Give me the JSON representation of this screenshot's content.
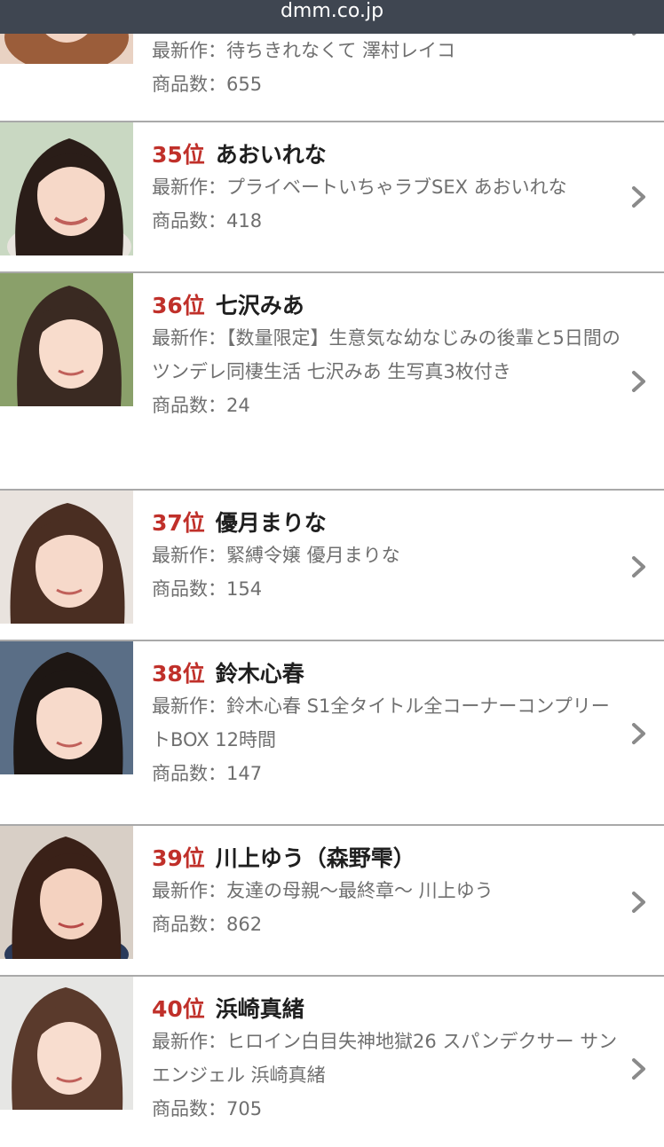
{
  "header": {
    "domain": "dmm.co.jp"
  },
  "labels": {
    "latest_prefix": "最新作：",
    "count_prefix": "商品数："
  },
  "rows": [
    {
      "rank": "",
      "name": "",
      "latest": "待ちきれなくて 澤村レイコ",
      "count": "655"
    },
    {
      "rank": "35位",
      "name": "あおいれな",
      "latest": "プライベートいちゃラブSEX あおいれな",
      "count": "418"
    },
    {
      "rank": "36位",
      "name": "七沢みあ",
      "latest": "【数量限定】生意気な幼なじみの後輩と5日間のツンデレ同棲生活 七沢みあ 生写真3枚付き",
      "count": "24"
    },
    {
      "rank": "37位",
      "name": "優月まりな",
      "latest": "緊縛令嬢 優月まりな",
      "count": "154"
    },
    {
      "rank": "38位",
      "name": "鈴木心春",
      "latest": "鈴木心春 S1全タイトル全コーナーコンプリートBOX 12時間",
      "count": "147"
    },
    {
      "rank": "39位",
      "name": "川上ゆう（森野雫）",
      "latest": "友達の母親〜最終章〜 川上ゆう",
      "count": "862"
    },
    {
      "rank": "40位",
      "name": "浜崎真緒",
      "latest": "ヒロイン白目失神地獄26 スパンデクサー サンエンジェル 浜崎真緒",
      "count": "705"
    }
  ],
  "colors": {
    "header_bg": "#3f4651",
    "rank_red": "#c0302a",
    "divider": "#a9a9a9",
    "muted_text": "#6f6f6f"
  },
  "icons": {
    "row_arrow": "chevron-right-icon"
  }
}
